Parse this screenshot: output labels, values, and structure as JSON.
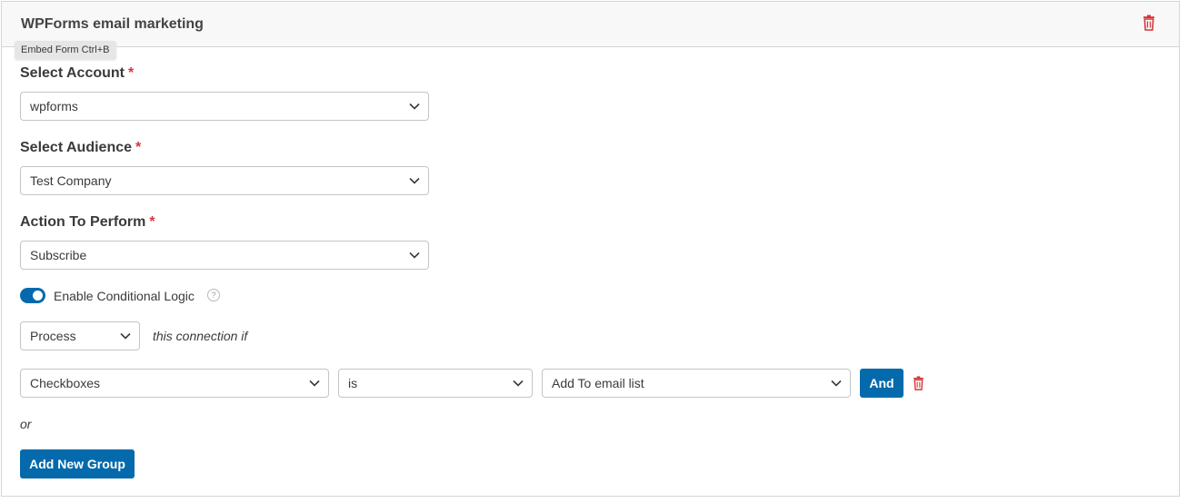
{
  "header": {
    "title": "WPForms email marketing",
    "tooltip": "Embed Form Ctrl+B",
    "trash_icon": "trash-icon"
  },
  "fields": {
    "account": {
      "label": "Select Account",
      "required_mark": "*",
      "value": "wpforms"
    },
    "audience": {
      "label": "Select Audience",
      "required_mark": "*",
      "value": "Test Company"
    },
    "action": {
      "label": "Action To Perform",
      "required_mark": "*",
      "value": "Subscribe"
    }
  },
  "conditional": {
    "toggle_label": "Enable Conditional Logic",
    "enabled": true,
    "help_glyph": "?",
    "process_value": "Process",
    "connection_text": "this connection if",
    "rule": {
      "field": "Checkboxes",
      "operator": "is",
      "value": "Add To email list",
      "and_label": "And"
    },
    "or_text": "or",
    "add_group_label": "Add New Group"
  },
  "colors": {
    "accent": "#056aab",
    "danger": "#d63638",
    "border": "#c3c4c7"
  }
}
